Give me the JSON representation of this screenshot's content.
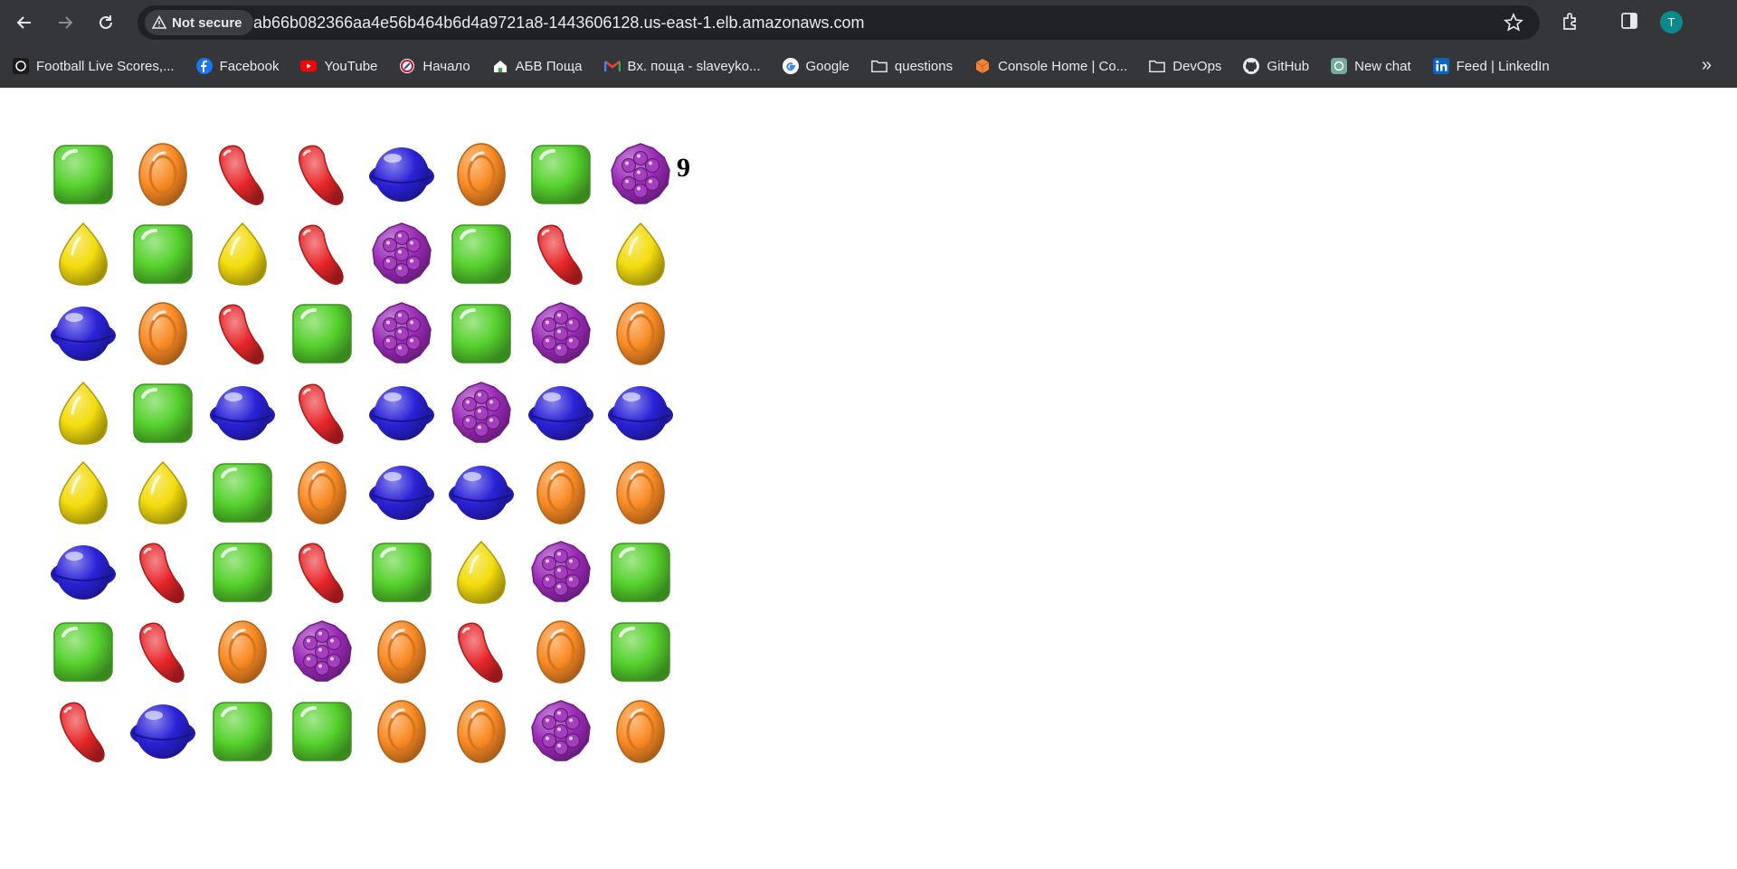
{
  "browser": {
    "security_label": "Not secure",
    "url": "ab66b082366aa4e56b464b6d4a9721a8-1443606128.us-east-1.elb.amazonaws.com",
    "profile_initial": "T",
    "bookmarks": [
      {
        "label": "Football Live Scores,...",
        "icon": "football-icon"
      },
      {
        "label": "Facebook",
        "icon": "facebook-icon"
      },
      {
        "label": "YouTube",
        "icon": "youtube-icon"
      },
      {
        "label": "Начало",
        "icon": "start-icon"
      },
      {
        "label": "АБВ Поща",
        "icon": "home-icon"
      },
      {
        "label": "Вх. поща - slaveyko...",
        "icon": "gmail-icon"
      },
      {
        "label": "Google",
        "icon": "google-icon"
      },
      {
        "label": "questions",
        "icon": "folder-icon"
      },
      {
        "label": "Console Home | Co...",
        "icon": "aws-icon"
      },
      {
        "label": "DevOps",
        "icon": "folder-icon"
      },
      {
        "label": "GitHub",
        "icon": "github-icon"
      },
      {
        "label": "New chat",
        "icon": "chatgpt-icon"
      },
      {
        "label": "Feed | LinkedIn",
        "icon": "linkedin-icon"
      }
    ]
  },
  "game": {
    "score": "9",
    "candy_colors": {
      "green": "#56d12e",
      "orange": "#f98a24",
      "red": "#e8262a",
      "blue": "#2a21d8",
      "purple": "#9b2ab8",
      "yellow": "#f3dc0e"
    },
    "board": [
      [
        "green",
        "orange",
        "red",
        "red",
        "blue",
        "orange",
        "green",
        "purple"
      ],
      [
        "yellow",
        "green",
        "yellow",
        "red",
        "purple",
        "green",
        "red",
        "yellow"
      ],
      [
        "blue",
        "orange",
        "red",
        "green",
        "purple",
        "green",
        "purple",
        "orange"
      ],
      [
        "yellow",
        "green",
        "blue",
        "red",
        "blue",
        "purple",
        "blue",
        "blue"
      ],
      [
        "yellow",
        "yellow",
        "green",
        "orange",
        "blue",
        "blue",
        "orange",
        "orange"
      ],
      [
        "blue",
        "red",
        "green",
        "red",
        "green",
        "yellow",
        "purple",
        "green"
      ],
      [
        "green",
        "red",
        "orange",
        "purple",
        "orange",
        "red",
        "orange",
        "green"
      ],
      [
        "red",
        "blue",
        "green",
        "green",
        "orange",
        "orange",
        "purple",
        "orange"
      ]
    ]
  }
}
